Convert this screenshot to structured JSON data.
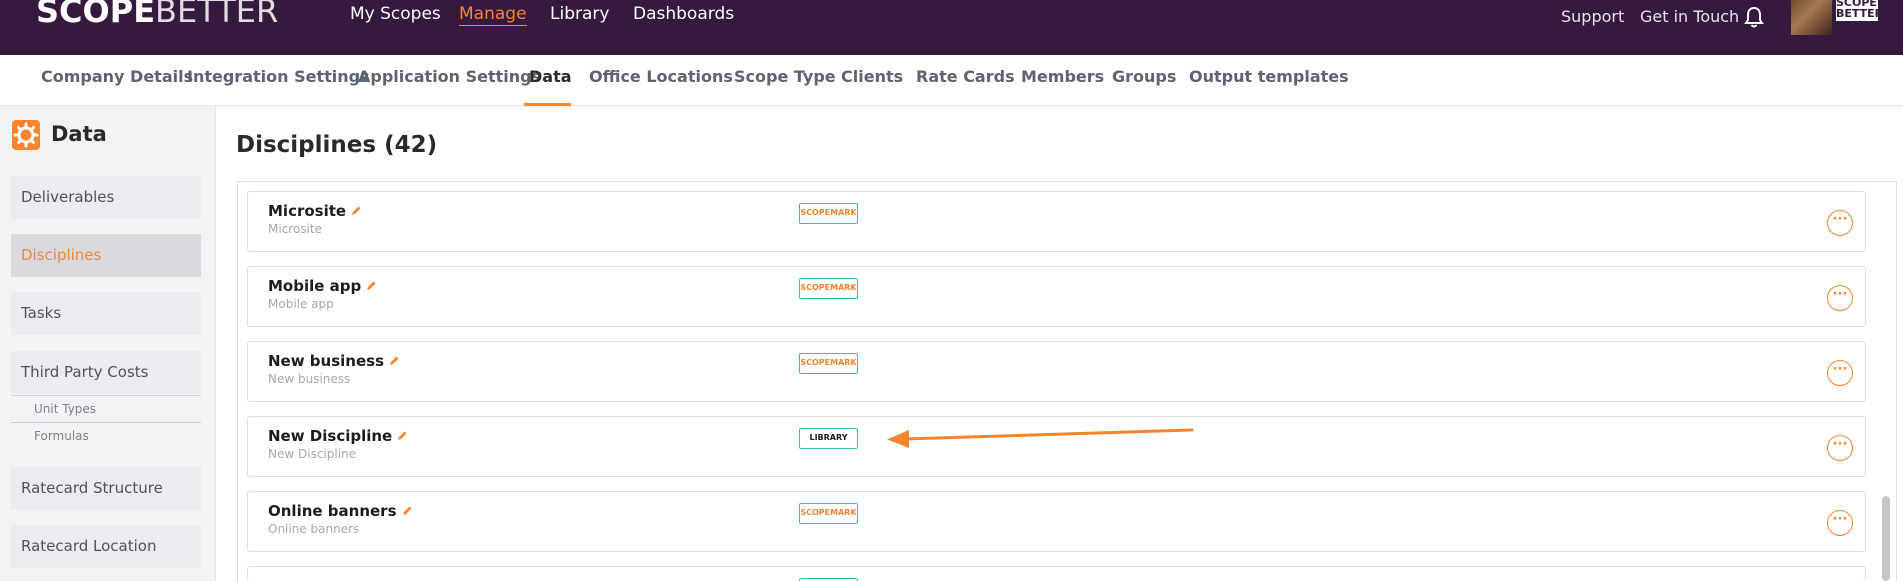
{
  "app": {
    "logo_bold": "SCOPE",
    "logo_light": "BETTER",
    "nav": [
      {
        "label": "My Scopes"
      },
      {
        "label": "Manage"
      },
      {
        "label": "Library"
      },
      {
        "label": "Dashboards"
      }
    ],
    "support_label": "Support",
    "contact_label": "Get in Touch",
    "avatar_logo_text": "SCOPE BETTER"
  },
  "subnav": {
    "items": [
      {
        "label": "Company Details"
      },
      {
        "label": "Integration Settings"
      },
      {
        "label": "Application Settings"
      },
      {
        "label": "Data"
      },
      {
        "label": "Office Locations"
      },
      {
        "label": "Scope Type"
      },
      {
        "label": "Clients"
      },
      {
        "label": "Rate Cards"
      },
      {
        "label": "Members"
      },
      {
        "label": "Groups"
      },
      {
        "label": "Output templates"
      }
    ],
    "active": "Data"
  },
  "sidebar": {
    "title": "Data",
    "items": [
      {
        "label": "Deliverables"
      },
      {
        "label": "Disciplines"
      },
      {
        "label": "Tasks"
      },
      {
        "label": "Third Party Costs"
      },
      {
        "label": "Ratecard Structure"
      },
      {
        "label": "Ratecard Location"
      }
    ],
    "subitems": [
      {
        "label": "Unit Types"
      },
      {
        "label": "Formulas"
      }
    ],
    "active": "Disciplines"
  },
  "main": {
    "title": "Disciplines (42)",
    "rows": [
      {
        "name": "Microsite",
        "sub": "Microsite",
        "tag": "SCOPEMARK"
      },
      {
        "name": "Mobile app",
        "sub": "Mobile app",
        "tag": "SCOPEMARK"
      },
      {
        "name": "New business",
        "sub": "New business",
        "tag": "SCOPEMARK"
      },
      {
        "name": "New Discipline",
        "sub": "New Discipline",
        "tag": "LIBRARY"
      },
      {
        "name": "Online banners",
        "sub": "Online banners",
        "tag": "SCOPEMARK"
      }
    ],
    "more_glyph": "···"
  },
  "colors": {
    "topbar": "#36193f",
    "accent": "#f7852e",
    "tag_border": "#37bfa7"
  },
  "icons": {
    "bell": "bell-icon",
    "gear": "gear-icon",
    "edit": "pencil-icon",
    "more": "more-options-icon",
    "annotation": "arrow-annotation-icon"
  }
}
